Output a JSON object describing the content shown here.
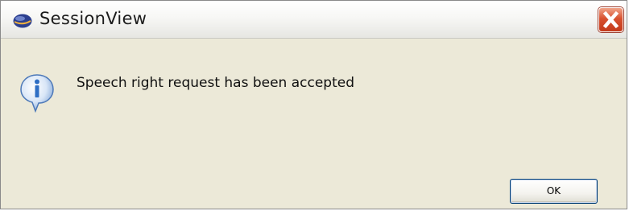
{
  "window": {
    "title": "SessionView",
    "app_icon": "app-logo-icon",
    "close_icon": "close-icon"
  },
  "dialog": {
    "icon": "info-icon",
    "message": "Speech right request has been accepted",
    "ok_label": "OK"
  },
  "colors": {
    "dialog_background": "#ece9d8",
    "close_button": "#d8512f",
    "info_icon_blue": "#2f6fc4"
  }
}
